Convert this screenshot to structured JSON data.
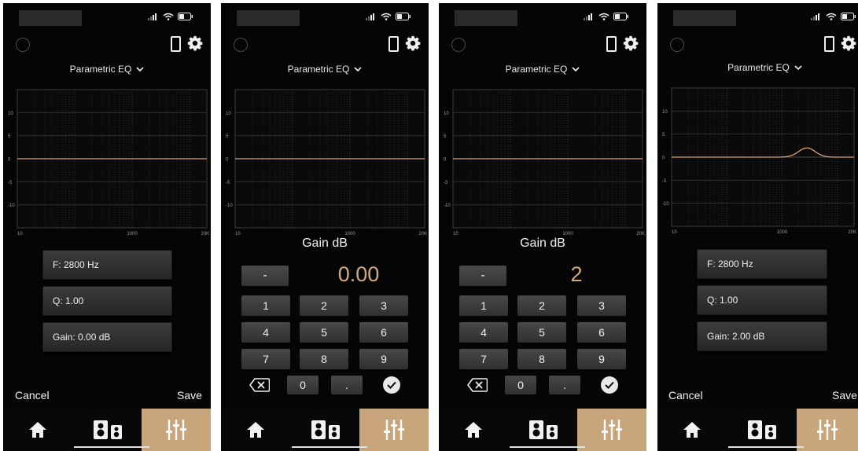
{
  "colors": {
    "accent": "#c9a57b",
    "value_text": "#d2aa7d",
    "curve": "#d9a272",
    "background": "#050505"
  },
  "icons": {
    "status": [
      "signal-icon",
      "wifi-icon",
      "battery-icon"
    ],
    "header": [
      "logo-icon",
      "phone-device-icon",
      "gear-icon"
    ],
    "tabs": [
      "home-icon",
      "speaker-icon",
      "equalizer-icon"
    ],
    "keypad": [
      "backspace-icon",
      "check-icon"
    ]
  },
  "graph": {
    "y_ticks": [
      "10",
      "5",
      "0",
      "-5",
      "-10"
    ],
    "x_ticks": [
      "10",
      "1000",
      "20K"
    ]
  },
  "screens": [
    {
      "eq_title": "Parametric EQ",
      "frequency": "F: 2800 Hz",
      "q": "Q: 1.00",
      "gain": "Gain: 0.00 dB",
      "cancel": "Cancel",
      "save": "Save",
      "curve_gain_db": 0
    },
    {
      "eq_title": "Parametric EQ",
      "keypad_title": "Gain dB",
      "minus": "-",
      "value": "0.00",
      "keys": [
        "1",
        "2",
        "3",
        "4",
        "5",
        "6",
        "7",
        "8",
        "9"
      ],
      "zero": "0",
      "dot": ".",
      "curve_gain_db": 0
    },
    {
      "eq_title": "Parametric EQ",
      "keypad_title": "Gain dB",
      "minus": "-",
      "value": "2",
      "keys": [
        "1",
        "2",
        "3",
        "4",
        "5",
        "6",
        "7",
        "8",
        "9"
      ],
      "zero": "0",
      "dot": ".",
      "curve_gain_db": 0
    },
    {
      "eq_title": "Parametric EQ",
      "frequency": "F: 2800 Hz",
      "q": "Q: 1.00",
      "gain": "Gain: 2.00 dB",
      "cancel": "Cancel",
      "save": "Save",
      "curve_gain_db": 2
    }
  ]
}
